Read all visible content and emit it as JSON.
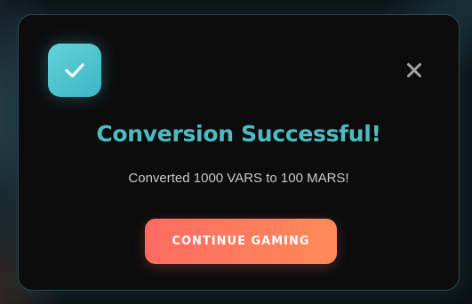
{
  "dialog": {
    "title": "Conversion Successful!",
    "message": "Converted 1000 VARS to 100 MARS!",
    "continue_label": "CONTINUE GAMING",
    "status_icon": "check-icon",
    "close_icon": "close-icon"
  },
  "colors": {
    "accent": "#4cbcc4",
    "badge": "#4fc4cf",
    "button_start": "#ff6b63",
    "button_end": "#ff8a58",
    "modal_bg": "#0c0c0d"
  }
}
